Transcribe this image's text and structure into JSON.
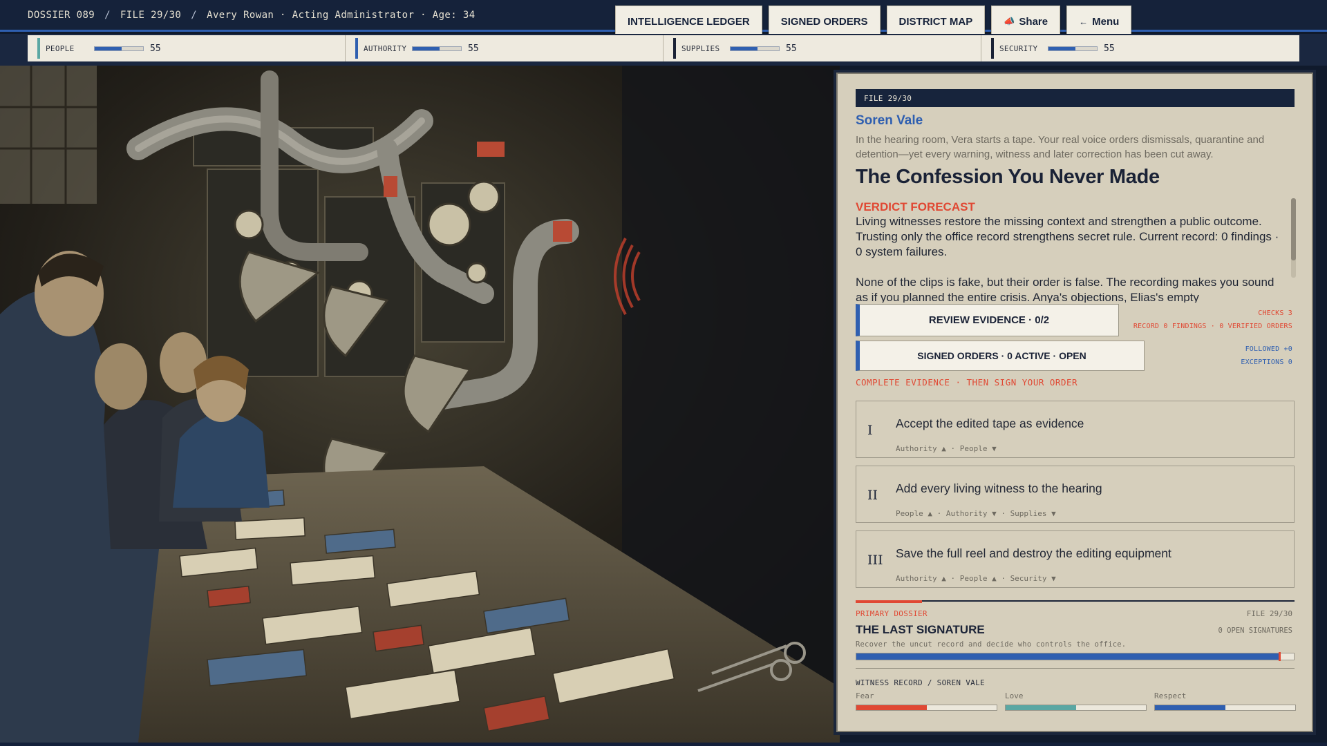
{
  "header": {
    "dossier": "DOSSIER 089",
    "file": "FILE 29/30",
    "character": "Avery Rowan · Acting Administrator · Age: 34",
    "separator": "/"
  },
  "nav": {
    "ledger": "INTELLIGENCE LEDGER",
    "orders": "SIGNED ORDERS",
    "map": "DISTRICT MAP",
    "share": "Share",
    "menu": "Menu"
  },
  "stats": [
    {
      "name": "PEOPLE",
      "value": "55",
      "level": 0.55,
      "color": "#5aa7a3"
    },
    {
      "name": "AUTHORITY",
      "value": "55",
      "level": 0.55,
      "color": "#2f5fb0"
    },
    {
      "name": "SUPPLIES",
      "value": "55",
      "level": 0.55,
      "color": "#1a2236"
    },
    {
      "name": "SECURITY",
      "value": "55",
      "level": 0.55,
      "color": "#1a2236"
    }
  ],
  "panel": {
    "file_tag": "FILE 29/30",
    "speaker": "Soren Vale",
    "intro": "In the hearing room, Vera starts a tape. Your real voice orders dismissals, quarantine and detention—yet every warning, witness and later correction has been cut away.",
    "title": "The Confession You Never Made",
    "forecast_label": "VERDICT FORECAST",
    "forecast_text": "Living witnesses restore the missing context and strengthen a public outcome. Trusting only the office record strengthens secret rule. Current record: 0 findings · 0 system failures.",
    "body_text": "None of the clips is fake, but their order is false. The recording makes you sound as if you planned the entire crisis. Anya's objections, Elias's empty",
    "review_button": "REVIEW EVIDENCE · 0/2",
    "orders_button": "SIGNED ORDERS · 0 ACTIVE · OPEN",
    "checks": "CHECKS 3",
    "record_summary": "RECORD 0 FINDINGS · 0 VERIFIED ORDERS",
    "followed": "FOLLOWED +0",
    "exceptions": "EXCEPTIONS 0",
    "instruction": "COMPLETE EVIDENCE · THEN SIGN YOUR ORDER"
  },
  "choices": [
    {
      "num": "I",
      "text": "Accept the edited tape as evidence",
      "effects": "Authority ▲  ·  People ▼"
    },
    {
      "num": "II",
      "text": "Add every living witness to the hearing",
      "effects": "People ▲  ·  Authority ▼  ·  Supplies ▼"
    },
    {
      "num": "III",
      "text": "Save the full reel and destroy the editing equipment",
      "effects": "Authority ▲  ·  People ▲  ·  Security ▼"
    }
  ],
  "primary_dossier": {
    "label": "PRIMARY DOSSIER",
    "file": "FILE 29/30",
    "title": "THE LAST SIGNATURE",
    "open": "0 OPEN SIGNATURES",
    "description": "Recover the uncut record and decide who controls the office.",
    "progress": 0.967
  },
  "witness_record": {
    "label": "WITNESS RECORD / SOREN VALE",
    "relations": [
      {
        "name": "Fear",
        "level": 0.5,
        "color": "#e04833"
      },
      {
        "name": "Love",
        "level": 0.5,
        "color": "#5aa7a3"
      },
      {
        "name": "Respect",
        "level": 0.5,
        "color": "#2f5fb0"
      }
    ]
  }
}
